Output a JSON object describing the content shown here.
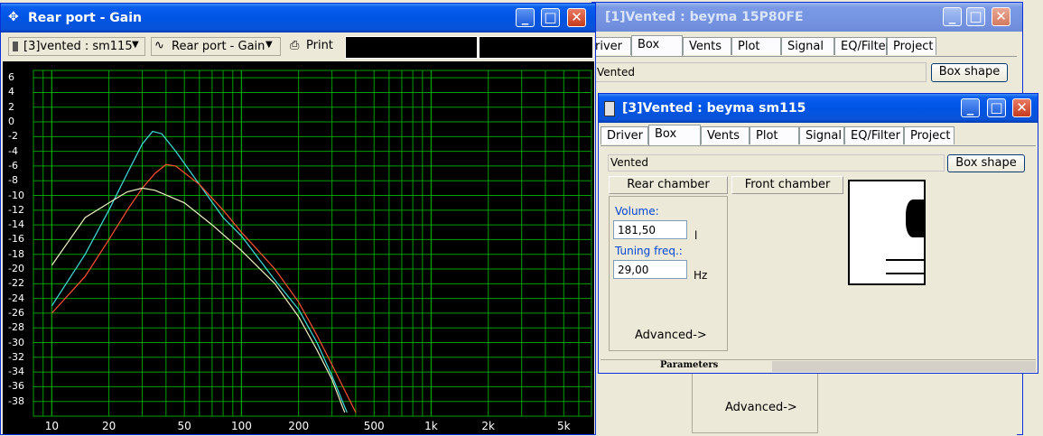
{
  "gain_window": {
    "title": "Rear port - Gain",
    "toolbar": {
      "model_select": "[3]vented : sm115",
      "plot_select": "Rear port - Gain",
      "print_label": "Print"
    }
  },
  "back_window": {
    "title": "[1]Vented : beyma  15P80FE",
    "tabs": [
      "river",
      "Box",
      "Vents",
      "Plot",
      "Signal",
      "EQ/Filter",
      "Project"
    ],
    "box_type": "Vented",
    "box_shape_label": "Box shape",
    "advanced_label": "Advanced->"
  },
  "front_window": {
    "title": "[3]Vented : beyma  sm115",
    "tabs": [
      "Driver",
      "Box",
      "Vents",
      "Plot",
      "Signal",
      "EQ/Filter",
      "Project"
    ],
    "box_type": "Vented",
    "box_shape_label": "Box shape",
    "rear_chamber_label": "Rear chamber",
    "front_chamber_label": "Front chamber",
    "volume_label": "Volume:",
    "volume_value": "181,50",
    "volume_unit": "l",
    "tuning_label": "Tuning freq.:",
    "tuning_value": "29,00",
    "tuning_unit": "Hz",
    "advanced_label": "Advanced->",
    "status_label": "Parameters"
  },
  "chart_data": {
    "type": "line",
    "x_scale": "log",
    "xlim": [
      8,
      7000
    ],
    "ylim": [
      -40,
      7
    ],
    "y_ticks": [
      6,
      4,
      2,
      0,
      -2,
      -4,
      -6,
      -8,
      -10,
      -12,
      -14,
      -16,
      -18,
      -20,
      -22,
      -24,
      -26,
      -28,
      -30,
      -32,
      -34,
      -36,
      -38
    ],
    "y_tick_labels": [
      "6",
      "4",
      "2",
      "0",
      "-2",
      "-4",
      "-6",
      "-8",
      "-10",
      "-12",
      "-14",
      "-16",
      "-18",
      "-20",
      "-22",
      "-24",
      "-26",
      "-28",
      "-30",
      "-32",
      "-34",
      "-36",
      "-38"
    ],
    "x_ticks": [
      10,
      20,
      50,
      100,
      200,
      500,
      1000,
      2000,
      5000
    ],
    "x_tick_labels": [
      "10",
      "20",
      "50",
      "100",
      "200",
      "500",
      "1k",
      "2k",
      "5k"
    ],
    "grid": true,
    "background": "#000000",
    "grid_color": "#00a000",
    "series": [
      {
        "color": "#40e0e0",
        "points": [
          [
            10,
            -25
          ],
          [
            15,
            -18
          ],
          [
            20,
            -12
          ],
          [
            25,
            -7
          ],
          [
            30,
            -3
          ],
          [
            34,
            -1.3
          ],
          [
            38,
            -1.6
          ],
          [
            45,
            -4
          ],
          [
            60,
            -8.5
          ],
          [
            80,
            -13
          ],
          [
            100,
            -15.5
          ],
          [
            150,
            -21.5
          ],
          [
            200,
            -25.5
          ],
          [
            250,
            -30
          ],
          [
            300,
            -34.5
          ],
          [
            360,
            -39.5
          ]
        ]
      },
      {
        "color": "#ff5030",
        "points": [
          [
            10,
            -26
          ],
          [
            15,
            -21
          ],
          [
            20,
            -16
          ],
          [
            25,
            -12
          ],
          [
            30,
            -9
          ],
          [
            35,
            -7
          ],
          [
            40,
            -5.8
          ],
          [
            45,
            -6
          ],
          [
            60,
            -8.5
          ],
          [
            80,
            -12
          ],
          [
            100,
            -15
          ],
          [
            150,
            -20
          ],
          [
            200,
            -24.5
          ],
          [
            250,
            -29
          ],
          [
            300,
            -33
          ],
          [
            400,
            -39.5
          ]
        ]
      },
      {
        "color": "#f0f0c0",
        "points": [
          [
            10,
            -19.5
          ],
          [
            15,
            -13
          ],
          [
            20,
            -11
          ],
          [
            25,
            -9.5
          ],
          [
            30,
            -9
          ],
          [
            35,
            -9.3
          ],
          [
            50,
            -11
          ],
          [
            70,
            -14
          ],
          [
            100,
            -17.5
          ],
          [
            150,
            -22
          ],
          [
            200,
            -26.5
          ],
          [
            250,
            -31
          ],
          [
            300,
            -35
          ],
          [
            350,
            -39.5
          ]
        ]
      }
    ]
  }
}
